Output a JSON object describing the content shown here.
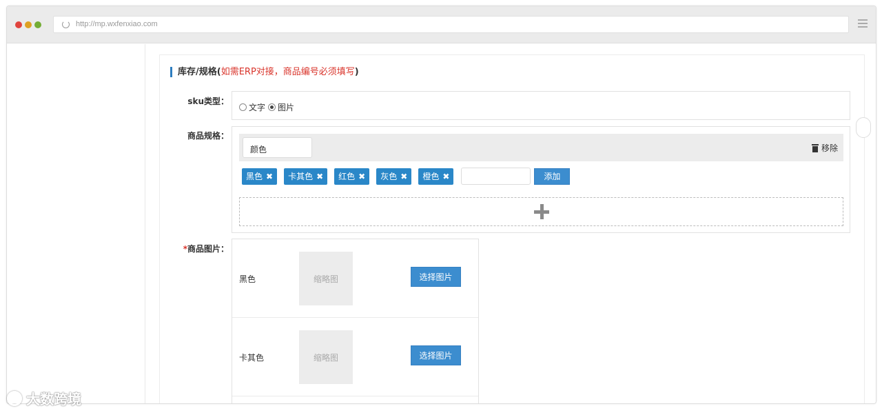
{
  "browser": {
    "url": "http://mp.wxfenxiao.com"
  },
  "section": {
    "title": "库存/规格(",
    "warning": "如需ERP对接，商品编号必须填写",
    "close": ")"
  },
  "sku": {
    "label": "sku类型：",
    "options": [
      "文字",
      "图片"
    ],
    "selected": "图片"
  },
  "spec": {
    "label": "商品规格：",
    "name_value": "颜色",
    "remove_label": "移除",
    "tags": [
      "黑色",
      "卡其色",
      "红色",
      "灰色",
      "橙色"
    ],
    "tag_input_value": "",
    "add_label": "添加"
  },
  "images": {
    "required_mark": "*",
    "label": "商品图片：",
    "rows": [
      {
        "name": "黑色",
        "thumb_label": "缩略图",
        "button": "选择图片"
      },
      {
        "name": "卡其色",
        "thumb_label": "缩略图",
        "button": "选择图片"
      }
    ]
  },
  "watermark": {
    "text": "大数跨境"
  },
  "colors": {
    "accent": "#2a87c8",
    "warning": "#d9342b"
  }
}
